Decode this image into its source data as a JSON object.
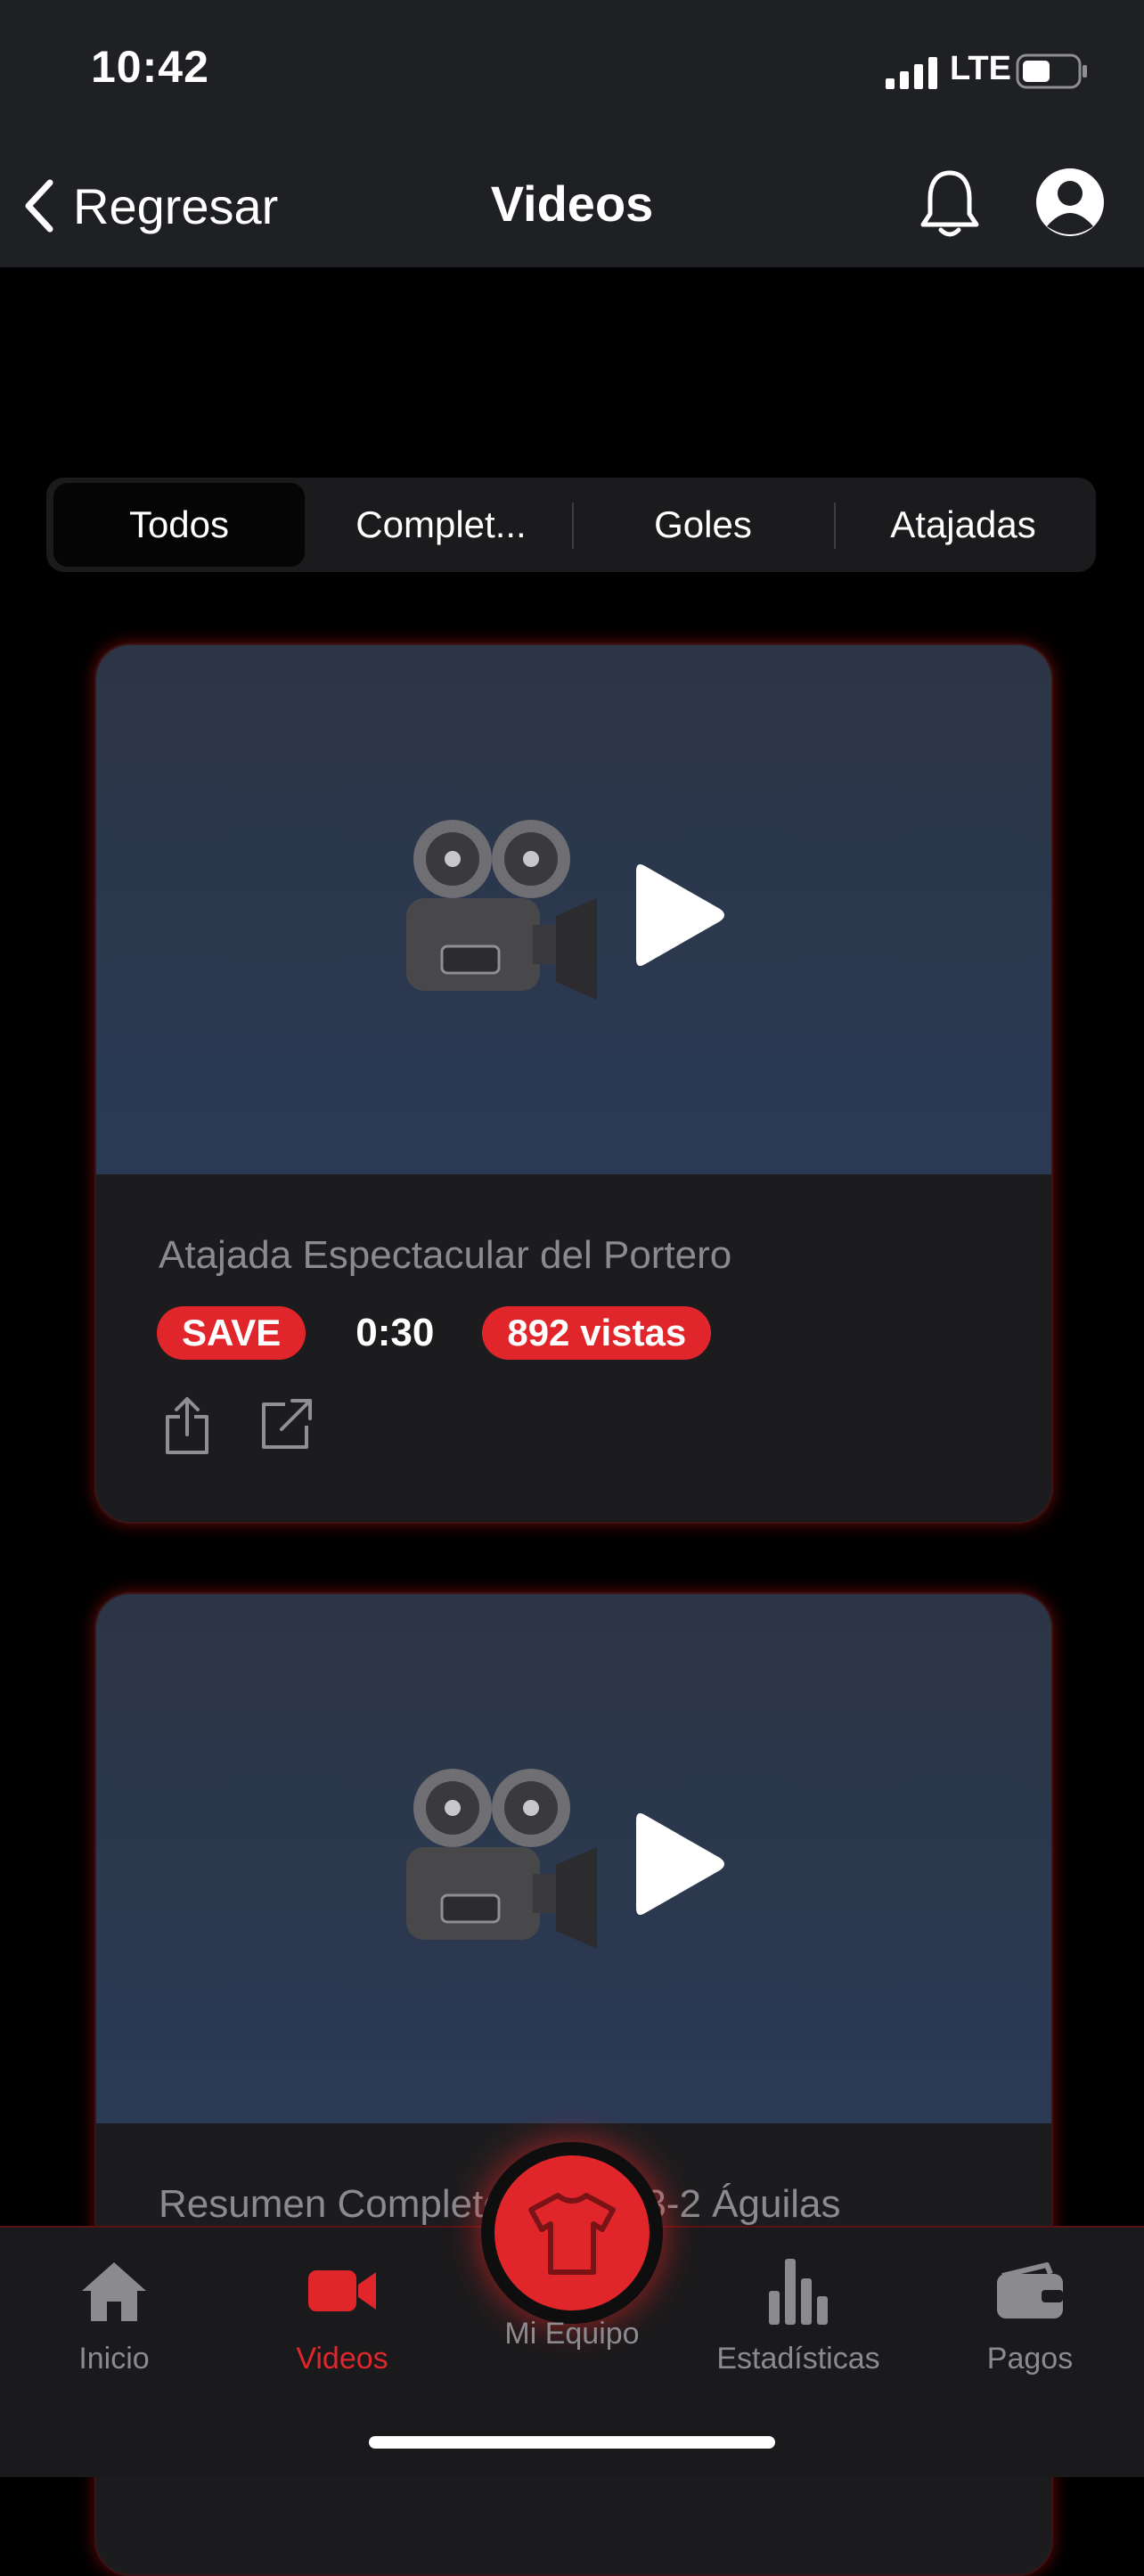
{
  "status": {
    "time": "10:42",
    "network": "LTE"
  },
  "nav": {
    "back_label": "Regresar",
    "title": "Videos"
  },
  "segments": [
    {
      "label": "Todos",
      "active": true
    },
    {
      "label": "Complet...",
      "active": false
    },
    {
      "label": "Goles",
      "active": false
    },
    {
      "label": "Atajadas",
      "active": false
    }
  ],
  "videos": [
    {
      "title": "Atajada Espectacular del Portero",
      "type_badge": "SAVE",
      "duration": "0:30",
      "views": "892 vistas"
    },
    {
      "title": "Resumen Completo: Tigres 3-2 Águilas"
    }
  ],
  "tabbar": {
    "items": [
      {
        "label": "Inicio",
        "icon": "home-icon"
      },
      {
        "label": "Videos",
        "icon": "video-camera-icon",
        "active": true
      },
      {
        "label": "Mi Equipo",
        "icon": "jersey-icon"
      },
      {
        "label": "Estadísticas",
        "icon": "bar-chart-icon"
      },
      {
        "label": "Pagos",
        "icon": "wallet-icon"
      }
    ]
  },
  "colors": {
    "accent": "#e0262b",
    "background": "#000000",
    "bar": "#1f2024",
    "card": "#1c1c1e"
  }
}
